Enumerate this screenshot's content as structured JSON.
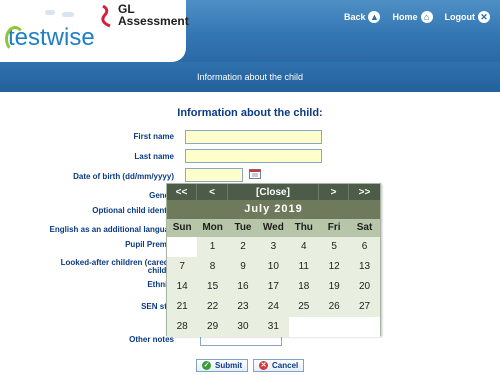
{
  "header": {
    "brand_logo_text": "testwise",
    "gl_line1": "GL",
    "gl_line2": "Assessment",
    "nav": [
      {
        "label": "Back",
        "icon": "arrow-up-icon"
      },
      {
        "label": "Home",
        "icon": "home-icon"
      },
      {
        "label": "Logout",
        "icon": "close-icon"
      }
    ]
  },
  "subbar": {
    "title": "Information about the child"
  },
  "form": {
    "title": "Information about the child:",
    "labels": {
      "first_name": "First name",
      "last_name": "Last name",
      "dob": "Date of birth (dd/mm/yyyy)",
      "gender": "Gende",
      "optional_id": "Optional child identifi",
      "eal": "English as an additional languag",
      "pupil_premium": "Pupil Premiu",
      "looked_after_1": "Looked-after children (cared-f",
      "looked_after_2": "childre",
      "ethnicity": "Ethnici",
      "sen": "SEN stat",
      "other_notes": "Other notes"
    },
    "values": {
      "first_name": "",
      "last_name": "",
      "dob": "",
      "other_notes": ""
    }
  },
  "buttons": {
    "submit": "Submit",
    "cancel": "Cancel"
  },
  "calendar": {
    "nav": [
      "<<",
      "<",
      "[Close]",
      ">",
      ">>"
    ],
    "month_label": "July 2019",
    "weekdays": [
      "Sun",
      "Mon",
      "Tue",
      "Wed",
      "Thu",
      "Fri",
      "Sat"
    ],
    "weeks": [
      [
        "",
        "1",
        "2",
        "3",
        "4",
        "5",
        "6"
      ],
      [
        "7",
        "8",
        "9",
        "10",
        "11",
        "12",
        "13"
      ],
      [
        "14",
        "15",
        "16",
        "17",
        "18",
        "19",
        "20"
      ],
      [
        "21",
        "22",
        "23",
        "24",
        "25",
        "26",
        "27"
      ],
      [
        "28",
        "29",
        "30",
        "31",
        "",
        "",
        ""
      ]
    ]
  },
  "colors": {
    "header_blue": "#3377b4",
    "label_navy": "#0b3a84",
    "input_yellow": "#ffffcc",
    "cal_nav_dark": "#4d5c49",
    "cal_month_bar": "#6f7a5c",
    "cal_weekday_bg": "#b7c6a8",
    "cal_cell_bg": "#e8efe0"
  }
}
